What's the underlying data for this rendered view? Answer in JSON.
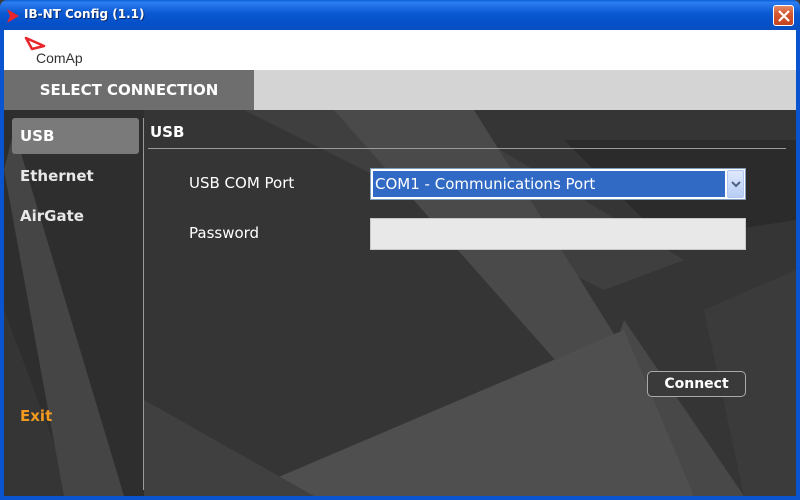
{
  "window": {
    "title": "IB-NT Config (1.1)"
  },
  "brand": {
    "logo_text": "ComAp",
    "accent_color": "#e8262c"
  },
  "header": {
    "section_title": "SELECT CONNECTION"
  },
  "sidebar": {
    "items": [
      {
        "label": "USB",
        "active": true
      },
      {
        "label": "Ethernet",
        "active": false
      },
      {
        "label": "AirGate",
        "active": false
      }
    ],
    "exit_label": "Exit"
  },
  "panel": {
    "title": "USB",
    "fields": {
      "com_port_label": "USB COM Port",
      "com_port_value": "COM1 - Communications Port",
      "password_label": "Password",
      "password_value": ""
    },
    "connect_label": "Connect"
  },
  "colors": {
    "exit": "#f39a1f",
    "selection": "#316ac5",
    "title_bar": "#0a58d2"
  }
}
